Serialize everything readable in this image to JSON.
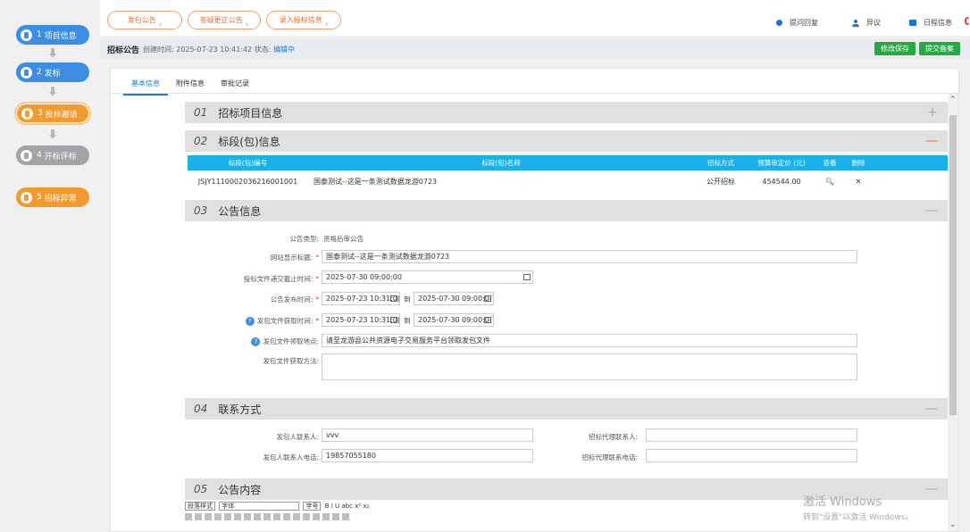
{
  "steps": [
    {
      "num": "1",
      "label": "项目信息"
    },
    {
      "num": "2",
      "label": "发标"
    },
    {
      "num": "3",
      "label": "投标邀请"
    },
    {
      "num": "4",
      "label": "开标评标"
    },
    {
      "num": "5",
      "label": "招标异常"
    }
  ],
  "top": {
    "pills": [
      "发包公告",
      "答疑更正公告",
      "录入投标信息"
    ],
    "pill_badge": "x",
    "links": [
      "提问回复",
      "异议",
      "日程信息"
    ]
  },
  "status": {
    "title": "招标公告",
    "created_label": "创建时间:",
    "created": "2025-07-23 10:41:42",
    "state_label": "状态:",
    "state": "编辑中",
    "save": "修改保存",
    "submit": "提交备案"
  },
  "tabs": [
    "基本信息",
    "附件信息",
    "审批记录"
  ],
  "sections": [
    {
      "num": "01",
      "title": "招标项目信息",
      "op": "+"
    },
    {
      "num": "02",
      "title": "标段(包)信息",
      "op": "—"
    },
    {
      "num": "03",
      "title": "公告信息",
      "op": "—"
    },
    {
      "num": "04",
      "title": "联系方式",
      "op": "—"
    },
    {
      "num": "05",
      "title": "公告内容",
      "op": "—"
    }
  ],
  "lot_table": {
    "headers": [
      "标段(包)编号",
      "标段(包)名称",
      "招标方式",
      "预算审定价 (元)",
      "查看",
      "删除"
    ],
    "row": {
      "code": "JSJY1110002036216001001",
      "name": "国泰测试--这是一条测试数据龙游0723",
      "method": "公开招标",
      "price": "454544.00",
      "view": "🔍",
      "del": "✕"
    }
  },
  "notice": {
    "type_label": "公告类型:",
    "type_value": "资格后审公告",
    "title_label": "网站显示标题:",
    "title_value": "国泰测试--这是一条测试数据龙游0723",
    "deadline_label": "投标文件递交截止时间:",
    "deadline_value": "2025-07-30 09:00:00",
    "publish_label": "公告发布时间:",
    "publish_from": "2025-07-23 10:31:0(",
    "publish_to": "2025-07-30 09:00:0(",
    "to": "到",
    "obtain_time_label": "发包文件获取时间:",
    "obtain_from": "2025-07-23 10:31:0(",
    "obtain_to": "2025-07-30 09:00:0(",
    "obtain_place_label": "发包文件领取地点:",
    "obtain_place_value": "请至龙游县公共资源电子交易服务平台领取发包文件",
    "obtain_method_label": "发包文件获取方法:",
    "obtain_method_value": ""
  },
  "contact": {
    "owner_label": "发包人联系人:",
    "owner_value": "vvv",
    "owner_phone_label": "发包人联系人电话:",
    "owner_phone_value": "19857055180",
    "agent_label": "招标代理联系人:",
    "agent_value": "",
    "agent_phone_label": "招标代理联系电话:",
    "agent_phone_value": ""
  },
  "editor": {
    "para": "段落样式",
    "font": "字体",
    "size": "字号",
    "fmt": "B I U abc x² x₂"
  },
  "watermark": {
    "line1": "激活 Windows",
    "line2": "转到\"设置\"以激活 Windows。"
  }
}
